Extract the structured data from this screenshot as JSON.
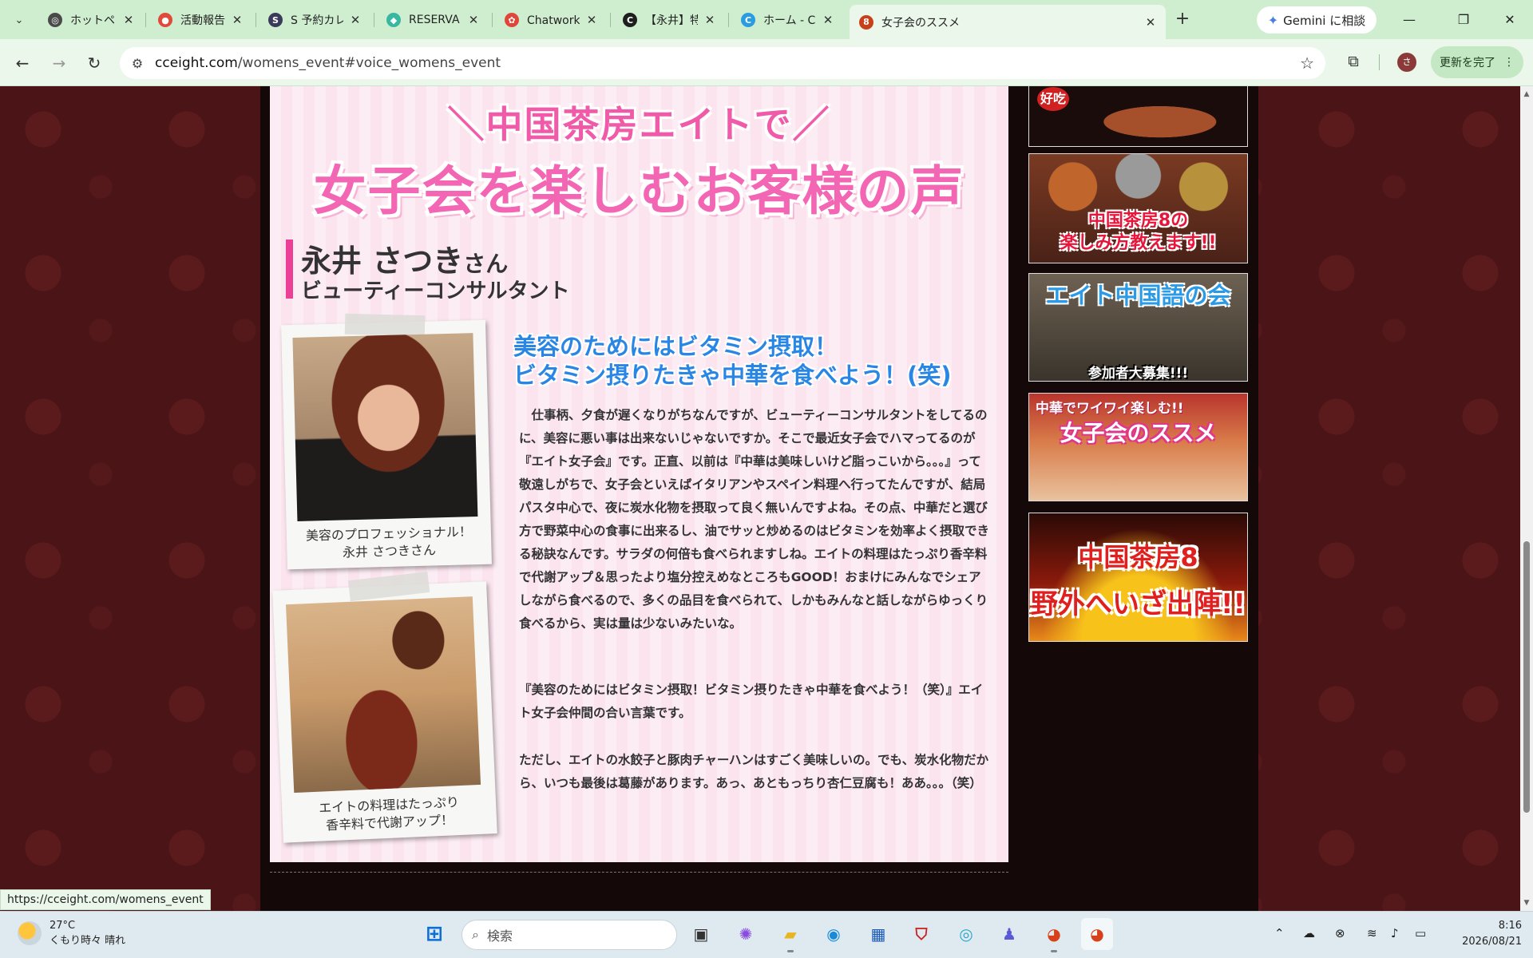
{
  "browser": {
    "tabs": [
      {
        "title": "ホットペッパーブ",
        "favicon_color": "#4a4a4a",
        "favicon_glyph": "◎"
      },
      {
        "title": "活動報告投稿",
        "favicon_color": "#e04a3a",
        "favicon_glyph": "●"
      },
      {
        "title": "S 予約カレンダ",
        "favicon_color": "#3a3a5a",
        "favicon_glyph": "S"
      },
      {
        "title": "RESERVA",
        "favicon_color": "#3ab7a0",
        "favicon_glyph": "◆"
      },
      {
        "title": "Chatwork - マ",
        "favicon_color": "#e0473a",
        "favicon_glyph": "✿"
      },
      {
        "title": "【永井】特別企",
        "favicon_color": "#1e1e1e",
        "favicon_glyph": "C"
      },
      {
        "title": "ホーム - Canva",
        "favicon_color": "#2a9de0",
        "favicon_glyph": "C"
      },
      {
        "title": "女子会のススメ",
        "favicon_color": "#c8401a",
        "favicon_glyph": "8"
      }
    ],
    "active_tab_index": 7,
    "new_tab_symbol": "+",
    "gemini_label": "Gemini に相談",
    "url_domain": "cceight.com",
    "url_path": "/womens_event#voice_womens_event",
    "update_label": "更新を完了",
    "avatar_letter": "さ",
    "status_url": "https://cceight.com/womens_event"
  },
  "page": {
    "headline_top": "＼中国茶房エイトで／",
    "headline_main": "女子会を楽しむお客様の声",
    "person_name": "永井 さつき",
    "person_suffix": "さん",
    "person_title": "ビューティーコンサルタント",
    "photo1_caption": [
      "美容のプロフェッショナル！",
      "永井 さつきさん"
    ],
    "photo2_caption": [
      "エイトの料理はたっぷり",
      "香辛料で代謝アップ！"
    ],
    "article_heading": [
      "美容のためにはビタミン摂取！",
      "ビタミン摂りたきゃ中華を食べよう！(笑)"
    ],
    "paragraphs": [
      "　仕事柄、夕食が遅くなりがちなんですが、ビューティーコンサルタントをしてるのに、美容に悪い事は出来ないじゃないですか。そこで最近女子会でハマってるのが『エイト女子会』です。正直、以前は『中華は美味しいけど脂っこいから。。。』って敬遠しがちで、女子会といえばイタリアンやスペイン料理へ行ってたんですが、結局パスタ中心で、夜に炭水化物を摂取って良く無いんですよね。その点、中華だと選び方で野菜中心の食事に出来るし、油でサッと炒めるのはビタミンを効率よく摂取できる秘訣なんです。サラダの何倍も食べられますしね。エイトの料理はたっぷり香辛料で代謝アップ＆思ったより塩分控えめなところもGOOD！おまけにみんなでシェアしながら食べるので、多くの品目を食べられて、しかもみんなと話しながらゆっくり食べるから、実は量は少ないみたいな。",
      "『美容のためにはビタミン摂取！ビタミン摂りたきゃ中華を食べよう！（笑）』エイト女子会仲間の合い言葉です。",
      "ただし、エイトの水餃子と豚肉チャーハンはすごく美味しいの。でも、炭水化物だから、いつも最後は葛藤があります。あっ、あともっちり杏仁豆腐も！ああ。。。（笑）"
    ]
  },
  "sidebar": {
    "banner0_text": "好吃",
    "banner1_lines": [
      "中国茶房8の",
      "楽しみ方教えます!!"
    ],
    "banner2_title": "エイト中国語の会",
    "banner2_sub": "参加者大募集!!!",
    "banner3_small": "中華でワイワイ楽しむ!!",
    "banner3_title": "女子会のススメ",
    "banner4_lines": [
      "中国茶房8",
      "野外へいざ出陣!!"
    ]
  },
  "taskbar": {
    "weather_temp": "27°C",
    "weather_desc": "くもり時々 晴れ",
    "search_placeholder": "検索",
    "time": "8:16",
    "date": "2026/08/21"
  },
  "colors": {
    "pink_headline": "#f266b4",
    "blue_heading": "#2a86e4",
    "page_bg": "#4b1417",
    "browser_chrome": "#cfeecf"
  }
}
